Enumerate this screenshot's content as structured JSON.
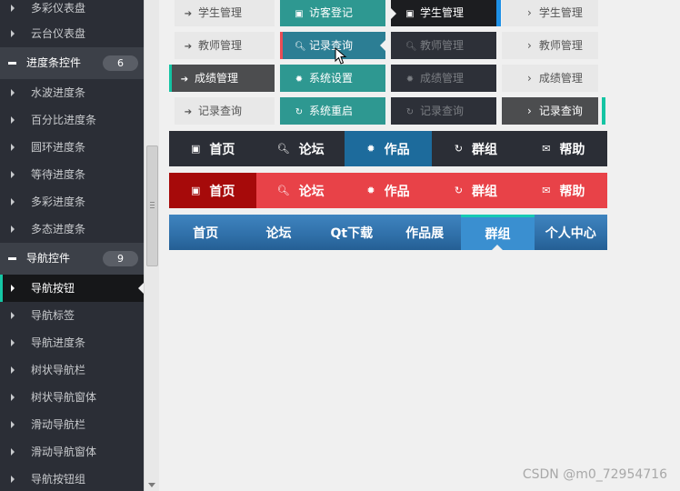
{
  "sidebar": {
    "items": [
      {
        "type": "child",
        "label": "多彩仪表盘"
      },
      {
        "type": "child",
        "label": "云台仪表盘"
      },
      {
        "type": "parent",
        "label": "进度条控件",
        "count": "6"
      },
      {
        "type": "child",
        "label": "水波进度条"
      },
      {
        "type": "child",
        "label": "百分比进度条"
      },
      {
        "type": "child",
        "label": "圆环进度条"
      },
      {
        "type": "child",
        "label": "等待进度条"
      },
      {
        "type": "child",
        "label": "多彩进度条"
      },
      {
        "type": "child",
        "label": "多态进度条"
      },
      {
        "type": "parent",
        "label": "导航控件",
        "count": "9"
      },
      {
        "type": "child",
        "label": "导航按钮",
        "active": true
      },
      {
        "type": "child",
        "label": "导航标签"
      },
      {
        "type": "child",
        "label": "导航进度条"
      },
      {
        "type": "child",
        "label": "树状导航栏"
      },
      {
        "type": "child",
        "label": "树状导航窗体"
      },
      {
        "type": "child",
        "label": "滑动导航栏"
      },
      {
        "type": "child",
        "label": "滑动导航窗体"
      },
      {
        "type": "child",
        "label": "导航按钮组"
      }
    ]
  },
  "grid": {
    "row1": [
      "学生管理",
      "访客登记",
      "学生管理",
      "学生管理"
    ],
    "row2": [
      "教师管理",
      "记录查询",
      "教师管理",
      "教师管理"
    ],
    "row3": [
      "成绩管理",
      "系统设置",
      "成绩管理",
      "成绩管理"
    ],
    "row4": [
      "记录查询",
      "系统重启",
      "记录查询",
      "记录查询"
    ]
  },
  "nav_dark": {
    "items": [
      "首页",
      "论坛",
      "作品",
      "群组",
      "帮助"
    ],
    "active": "作品"
  },
  "nav_red": {
    "items": [
      "首页",
      "论坛",
      "作品",
      "群组",
      "帮助"
    ],
    "active": "首页"
  },
  "nav_blue": {
    "items": [
      "首页",
      "论坛",
      "Qt下载",
      "作品展",
      "群组",
      "个人中心"
    ],
    "active": "群组"
  },
  "watermark": "CSDN @m0_72954716",
  "colors": {
    "sidebar_bg": "#2b2e36",
    "sidebar_parent_bg": "#3c4048",
    "accent_teal": "#14c4a3",
    "teal_button": "#2e9891",
    "nav_active_blue": "#1d6b9c",
    "nav_red": "#e84248",
    "nav_red_active": "#a60a0a",
    "nav_blue": "#2f6fa8"
  }
}
